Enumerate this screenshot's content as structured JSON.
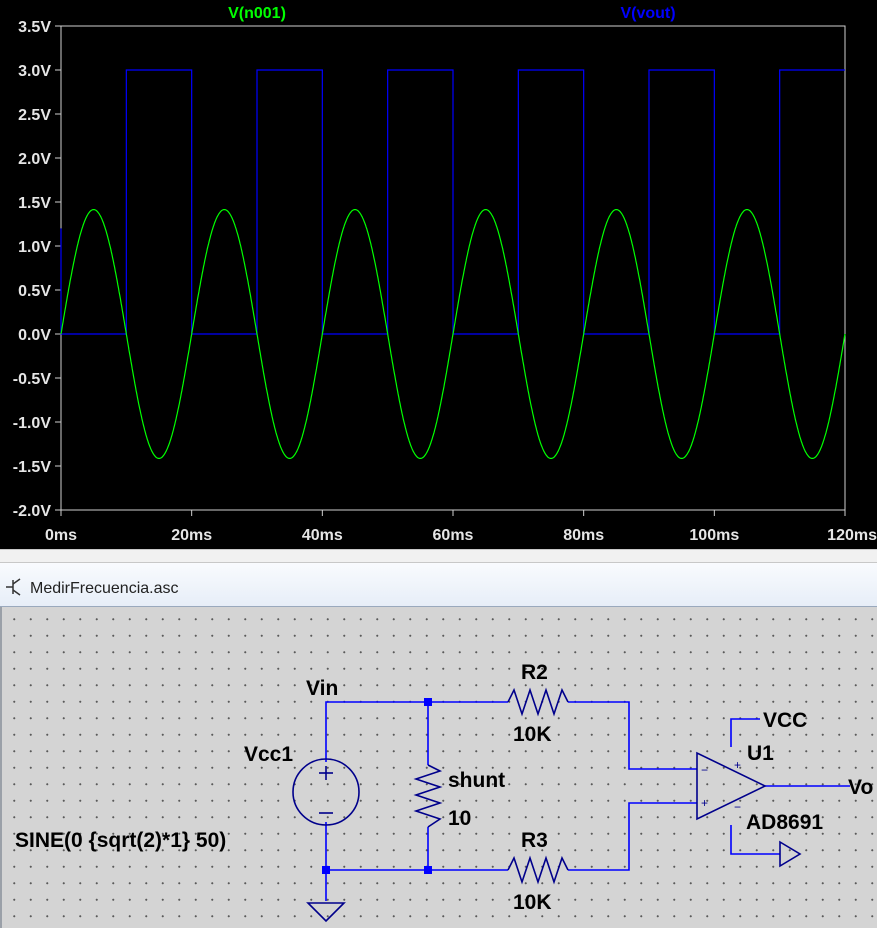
{
  "waveform": {
    "traces": [
      {
        "name": "V(n001)",
        "color": "#00ff00"
      },
      {
        "name": "V(vout)",
        "color": "#0000ff"
      }
    ],
    "y_ticks": [
      "3.5V",
      "3.0V",
      "2.5V",
      "2.0V",
      "1.5V",
      "1.0V",
      "0.5V",
      "0.0V",
      "-0.5V",
      "-1.0V",
      "-1.5V",
      "-2.0V"
    ],
    "x_ticks": [
      "0ms",
      "20ms",
      "40ms",
      "60ms",
      "80ms",
      "100ms",
      "120ms"
    ],
    "background": "#000000",
    "text_color": "#e6e6e6"
  },
  "chart_data": {
    "type": "line",
    "title": "",
    "xlabel": "",
    "ylabel": "",
    "x_unit": "ms",
    "y_unit": "V",
    "xlim": [
      0,
      120
    ],
    "ylim": [
      -2.0,
      3.5
    ],
    "grid": false,
    "legend_placement": "top",
    "series": [
      {
        "name": "V(n001)",
        "kind": "sine",
        "amplitude": 1.414,
        "frequency_hz": 50,
        "offset": 0,
        "color": "#00ff00"
      },
      {
        "name": "V(vout)",
        "kind": "square",
        "high": 3.0,
        "low": 0.0,
        "frequency_hz": 50,
        "color": "#0000ff"
      }
    ]
  },
  "schematic_window": {
    "title": "MedirFrecuencia.asc",
    "icon": "schematic-icon"
  },
  "schematic": {
    "net_vin": "Vin",
    "r2_name": "R2",
    "r2_value": "10K",
    "r3_name": "R3",
    "r3_value": "10K",
    "source_name": "Vcc1",
    "source_value": "SINE(0 {sqrt(2)*1} 50)",
    "shunt_name": "shunt",
    "shunt_value": "10",
    "vcc_label": "VCC",
    "opamp_name": "U1",
    "opamp_model": "AD8691",
    "vout_label": "Vo",
    "plus_sign": "+",
    "minus_sign": "−"
  }
}
